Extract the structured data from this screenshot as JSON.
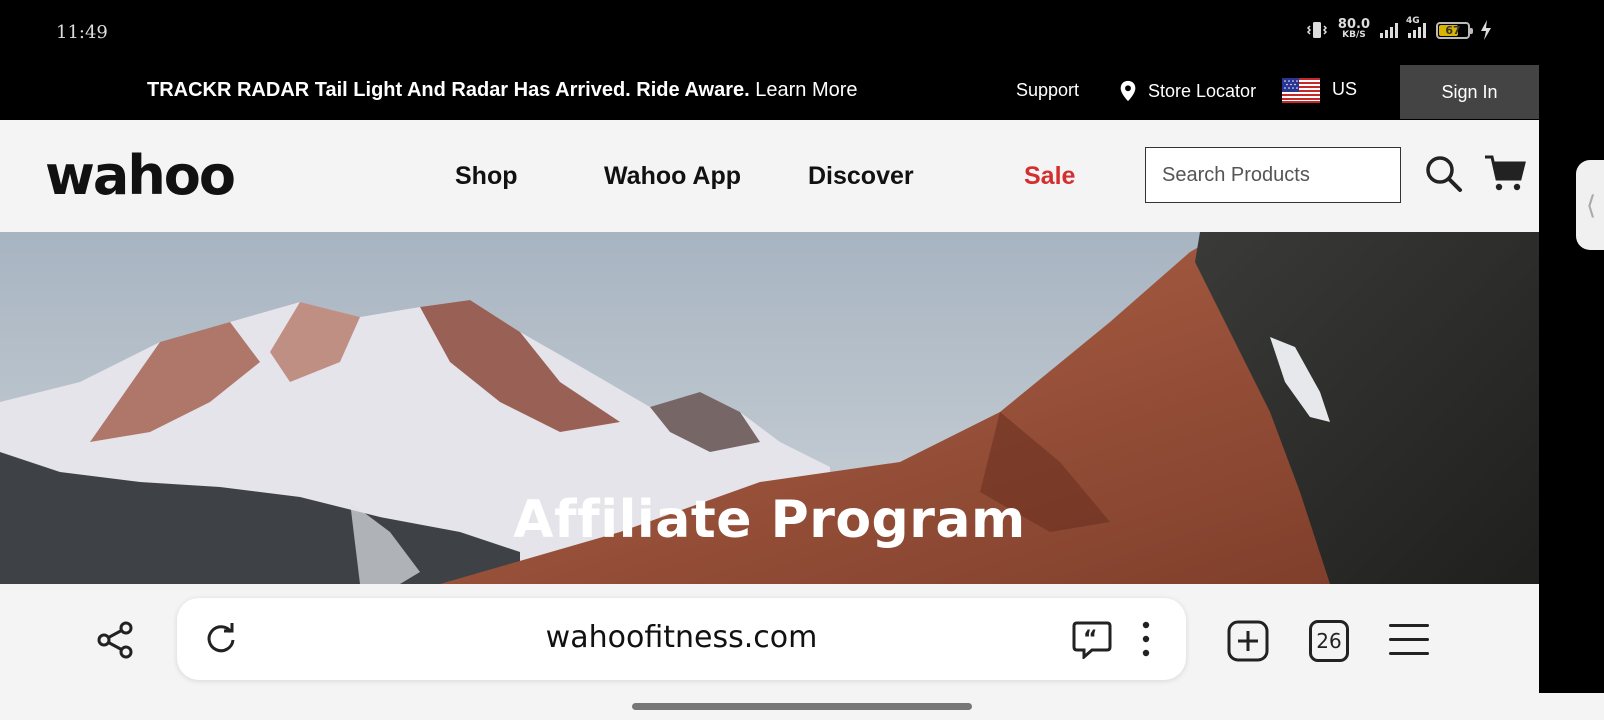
{
  "status_bar": {
    "time": "11:49",
    "net_speed_value": "80.0",
    "net_speed_unit": "KB/S",
    "network_type": "4G",
    "battery_level": "67",
    "battery_color": "#d9b400"
  },
  "announcement": {
    "headline": "TRACKR RADAR Tail Light And Radar Has Arrived. Ride Aware.",
    "link": "Learn More"
  },
  "utility_nav": {
    "support": "Support",
    "store_locator": "Store Locator",
    "region": "US",
    "sign_in": "Sign In"
  },
  "brand": {
    "logo": "wahoo"
  },
  "main_nav": {
    "items": [
      "Shop",
      "Wahoo App",
      "Discover",
      "Sale"
    ],
    "sale_color": "#d32f2f"
  },
  "search": {
    "placeholder": "Search Products"
  },
  "hero": {
    "title": "Affiliate Program"
  },
  "browser": {
    "url": "wahoofitness.com",
    "tab_count": "26"
  },
  "icons": [
    "vibrate-icon",
    "signal-icon",
    "battery-icon",
    "charging-icon",
    "location-pin-icon",
    "us-flag-icon",
    "search-icon",
    "cart-icon",
    "share-icon",
    "reload-icon",
    "reader-mode-icon",
    "more-icon",
    "new-tab-icon",
    "tabs-icon",
    "menu-icon",
    "edge-panel-handle-icon"
  ]
}
